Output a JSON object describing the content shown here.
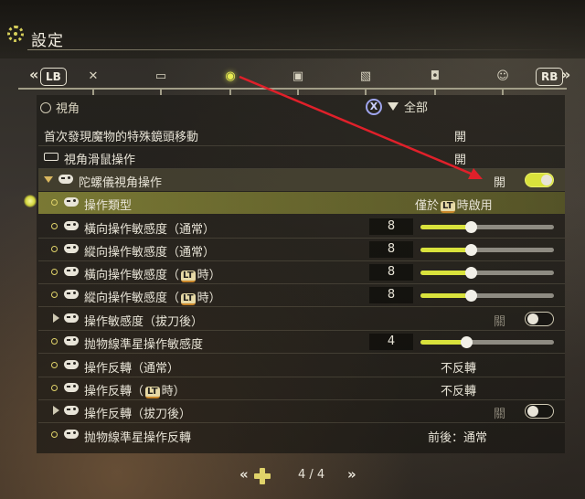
{
  "header": {
    "title": "設定"
  },
  "nav": {
    "lb": "LB",
    "rb": "RB",
    "left_chev": "«",
    "right_chev": "»",
    "tabs": [
      {
        "icon": "sword-cross-icon"
      },
      {
        "icon": "gamepad-icon"
      },
      {
        "icon": "camera-icon",
        "active": true
      },
      {
        "icon": "display-icon"
      },
      {
        "icon": "image-icon"
      },
      {
        "icon": "speaker-icon"
      },
      {
        "icon": "accessibility-icon"
      }
    ]
  },
  "section": {
    "title": "視角"
  },
  "filter": {
    "button": "X",
    "label": "全部"
  },
  "rows": [
    {
      "label": "首次發現魔物的特殊鏡頭移動",
      "value": "開"
    },
    {
      "label": "視角滑鼠操作",
      "value": "開"
    },
    {
      "label": "陀螺儀視角操作",
      "value": "開",
      "toggle": "on"
    },
    {
      "label": "操作類型",
      "value_pre": "僅於",
      "value_lt": "LT",
      "value_post": "時啟用"
    },
    {
      "label": "橫向操作敏感度（通常）",
      "num": "8",
      "fraction": 0.38
    },
    {
      "label": "縱向操作敏感度（通常）",
      "num": "8",
      "fraction": 0.38
    },
    {
      "label_pre": "橫向操作敏感度（",
      "label_lt": "LT",
      "label_post": "時）",
      "num": "8",
      "fraction": 0.38
    },
    {
      "label_pre": "縱向操作敏感度（",
      "label_lt": "LT",
      "label_post": "時）",
      "num": "8",
      "fraction": 0.38
    },
    {
      "label": "操作敏感度（拔刀後）",
      "value": "關",
      "toggle": "off"
    },
    {
      "label": "抛物線準星操作敏感度",
      "num": "4",
      "fraction": 0.34
    },
    {
      "label": "操作反轉（通常）",
      "value": "不反轉"
    },
    {
      "label_pre": "操作反轉（",
      "label_lt": "LT",
      "label_post": "時）",
      "value": "不反轉"
    },
    {
      "label": "操作反轉（拔刀後）",
      "value": "關",
      "toggle": "off"
    },
    {
      "label": "抛物線準星操作反轉",
      "value": "前後：通常"
    }
  ],
  "pager": {
    "left": "«",
    "right": "»",
    "text": "4 / 4"
  },
  "colors": {
    "accent": "#d9e23c",
    "annotation": "#e0202a"
  }
}
